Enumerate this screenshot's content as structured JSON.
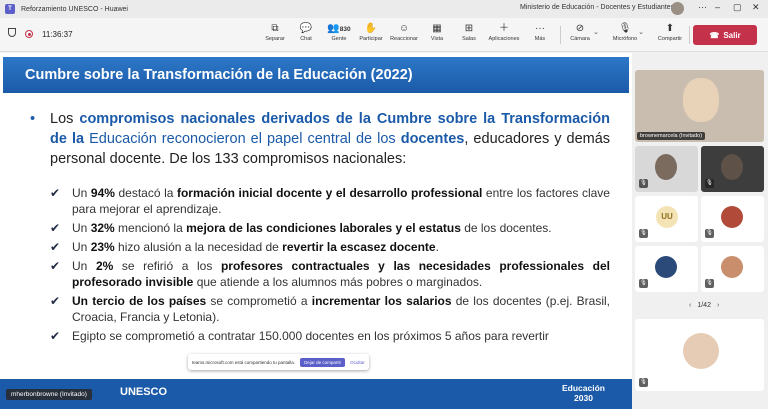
{
  "titlebar": {
    "app_title": "Reforzamiento UNESCO - Huawei",
    "window_title": "Ministerio de Educación - Docentes y Estudiantes"
  },
  "toolbar": {
    "timer": "11:36:37",
    "buttons": [
      {
        "label": "Separar",
        "icon": "pop-out-icon"
      },
      {
        "label": "Chat",
        "icon": "chat-icon"
      },
      {
        "label": "Gente",
        "icon": "people-icon",
        "count": "830"
      },
      {
        "label": "Participar",
        "icon": "raise-hand-icon"
      },
      {
        "label": "Reaccionar",
        "icon": "react-icon"
      },
      {
        "label": "Vista",
        "icon": "view-icon"
      },
      {
        "label": "Salas",
        "icon": "rooms-icon"
      },
      {
        "label": "Aplicaciones",
        "icon": "apps-icon"
      },
      {
        "label": "Más",
        "icon": "more-icon"
      },
      {
        "label": "Cámara",
        "icon": "camera-off-icon"
      },
      {
        "label": "Micrófono",
        "icon": "mic-off-icon"
      },
      {
        "label": "Compartir",
        "icon": "share-icon"
      }
    ],
    "leave_label": "Salir"
  },
  "slide": {
    "title": "Cumbre sobre la Transformación de la Educación (2022)",
    "main_bullet": {
      "t1": "Los ",
      "hl1": "compromisos nacionales derivados de la Cumbre sobre la Transformación de la",
      "t2": " ",
      "hl2": "Educación reconocieron el papel central de los",
      "t3": " ",
      "hl3": "docentes",
      "t4": ", educadores y demás personal docente. De los 133 compromisos nacionales:"
    },
    "subs": [
      {
        "a": "Un ",
        "b": "94%",
        "c": " destacó la ",
        "d": "formación inicial docente y el desarrollo professional",
        "e": " entre los factores clave para mejorar el aprendizaje."
      },
      {
        "a": "Un ",
        "b": "32%",
        "c": " mencionó la ",
        "d": "mejora de las condiciones laborales y el estatus",
        "e": " de los docentes."
      },
      {
        "a": "Un ",
        "b": "23%",
        "c": " hizo alusión a la necesidad de ",
        "d": "revertir la escasez docente",
        "e": "."
      },
      {
        "a": "Un ",
        "b": "2%",
        "c": " se refirió a los ",
        "d": "profesores contractuales y las necesidades professionales del profesorado invisible",
        "e": " que atiende a los alumnos más pobres o marginados."
      },
      {
        "a": "",
        "b": "Un tercio de los países",
        "c": " se comprometió a ",
        "d": "incrementar los salarios",
        "e": " de los docentes (p.ej. Brasil, Croacia, Francia y Letonia)."
      },
      {
        "a": "Egipto se comprometió a contratar 150.000 docentes en los próximos 5 años para revertir",
        "b": "",
        "c": "",
        "d": "",
        "e": ""
      }
    ],
    "footer_logo": "UNESCO",
    "footer_edu_line1": "Educación",
    "footer_edu_line2": "2030"
  },
  "presenter_tag": "mherbonbrowne (Invitado)",
  "share_banner": {
    "text": "teams.microsoft.com está compartiendo tu pantalla.",
    "stop_label": "Dejar de compartir",
    "hide_label": "Ocultar"
  },
  "participants": {
    "main_label": "brownemarcela (Invitado)",
    "initials": "UU",
    "pager": "1/42"
  },
  "colors": {
    "accent_blue": "#1b5aa8",
    "leave_red": "#c4314b",
    "teams_purple": "#5b5fc7"
  }
}
